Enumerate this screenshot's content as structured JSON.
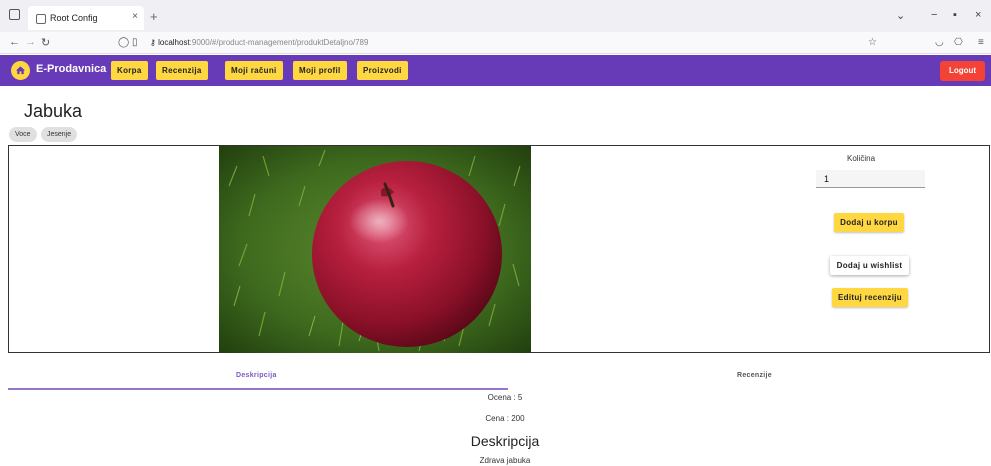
{
  "browser": {
    "tab_title": "Root Config",
    "tab_close": "×",
    "new_tab": "+",
    "url_host": "localhost",
    "url_rest": ":9000/#/product-management/produktDetaljno/789"
  },
  "app": {
    "brand": "E-Prodavnica",
    "nav": [
      "Korpa",
      "Recenzija",
      "Moji računi",
      "Moji profil",
      "Proizvodi"
    ],
    "logout": "Logout",
    "accent": "#673ab7",
    "button_color": "#ffd740",
    "logout_color": "#f44336"
  },
  "product": {
    "title": "Jabuka",
    "tags": [
      "Voce",
      "Jesenje"
    ],
    "quantity_label": "Količina",
    "quantity_value": "1",
    "add_to_cart": "Dodaj u korpu",
    "add_to_wishlist": "Dodaj u wishlist",
    "edit_review": "Edituj recenziju"
  },
  "tabs": {
    "description": "Deskripcija",
    "reviews": "Recenzije"
  },
  "details": {
    "rating_label": "Ocena :",
    "rating_value": "5",
    "price_label": "Cena :",
    "price_value": "200",
    "description_heading": "Deskripcija",
    "description_text": "Zdrava jabuka"
  }
}
